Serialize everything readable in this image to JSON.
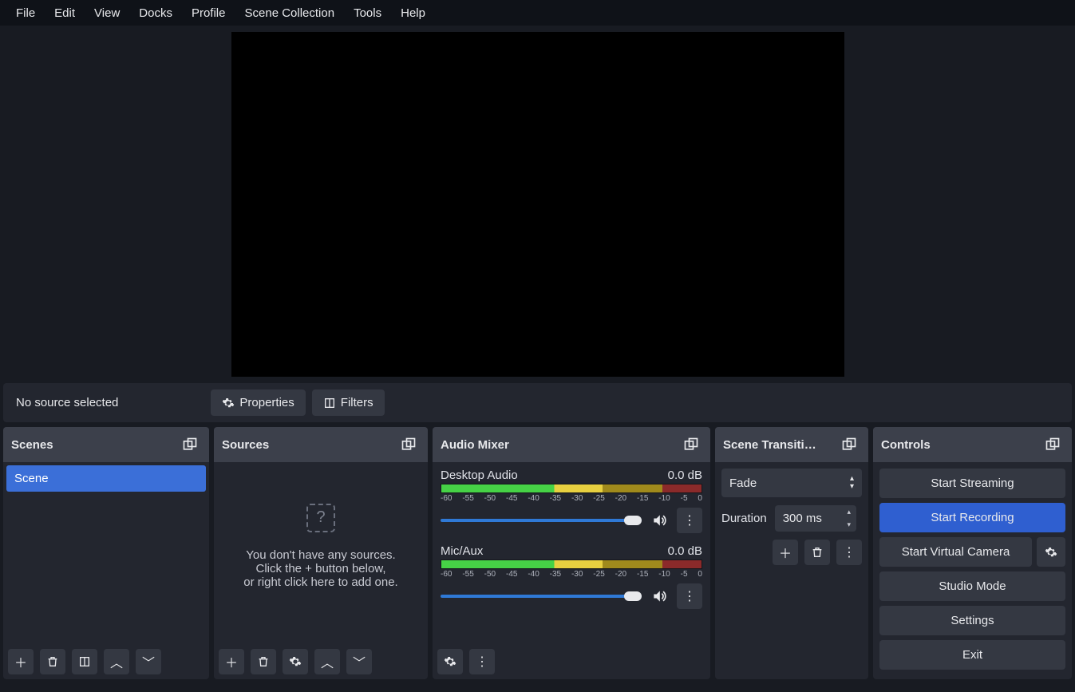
{
  "menubar": [
    "File",
    "Edit",
    "View",
    "Docks",
    "Profile",
    "Scene Collection",
    "Tools",
    "Help"
  ],
  "source_toolbar": {
    "status": "No source selected",
    "properties": "Properties",
    "filters": "Filters"
  },
  "scenes": {
    "title": "Scenes",
    "items": [
      "Scene"
    ]
  },
  "sources": {
    "title": "Sources",
    "empty_line1": "You don't have any sources.",
    "empty_line2": "Click the + button below,",
    "empty_line3": "or right click here to add one."
  },
  "mixer": {
    "title": "Audio Mixer",
    "ticks": [
      "-60",
      "-55",
      "-50",
      "-45",
      "-40",
      "-35",
      "-30",
      "-25",
      "-20",
      "-15",
      "-10",
      "-5",
      "0"
    ],
    "channels": [
      {
        "name": "Desktop Audio",
        "level": "0.0 dB",
        "fill_pct": 62
      },
      {
        "name": "Mic/Aux",
        "level": "0.0 dB",
        "fill_pct": 62
      }
    ]
  },
  "transitions": {
    "title": "Scene Transiti…",
    "selected": "Fade",
    "duration_label": "Duration",
    "duration_value": "300 ms"
  },
  "controls": {
    "title": "Controls",
    "buttons": {
      "start_streaming": "Start Streaming",
      "start_recording": "Start Recording",
      "start_virtual_camera": "Start Virtual Camera",
      "studio_mode": "Studio Mode",
      "settings": "Settings",
      "exit": "Exit"
    }
  }
}
